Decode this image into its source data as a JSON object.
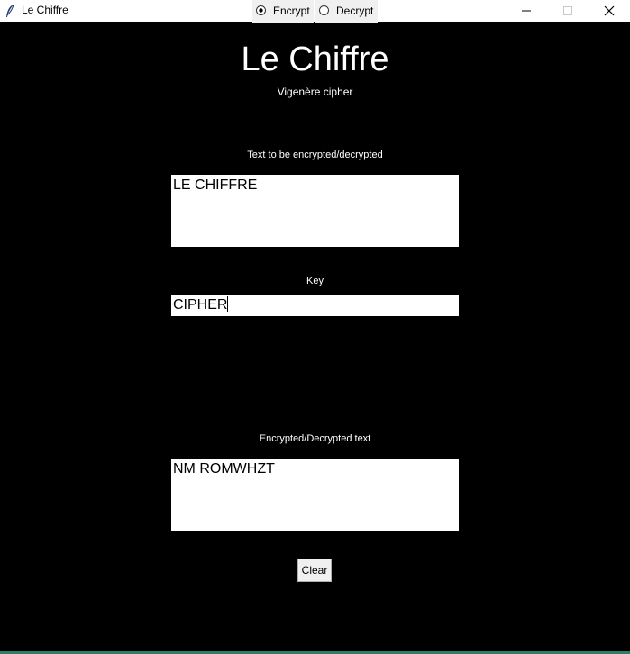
{
  "window": {
    "title": "Le Chiffre"
  },
  "app": {
    "title": "Le Chiffre",
    "subtitle": "Vigenère cipher"
  },
  "input": {
    "label": "Text to be encrypted/decrypted",
    "value": "LE CHIFFRE"
  },
  "key": {
    "label": "Key",
    "value": "CIPHER"
  },
  "mode": {
    "options": [
      {
        "label": "Encrypt",
        "selected": true
      },
      {
        "label": "Decrypt",
        "selected": false
      }
    ]
  },
  "output": {
    "label": "Encrypted/Decrypted text",
    "value": "NM ROMWHZT"
  },
  "actions": {
    "clear_label": "Clear"
  },
  "colors": {
    "background": "#000000",
    "text": "#ffffff",
    "field": "#ffffff",
    "button": "#f0f0f0",
    "accent": "#2d7d6a"
  },
  "icons": {
    "app": "feather-icon",
    "minimize": "minimize-icon",
    "maximize": "maximize-icon",
    "close": "close-icon"
  }
}
